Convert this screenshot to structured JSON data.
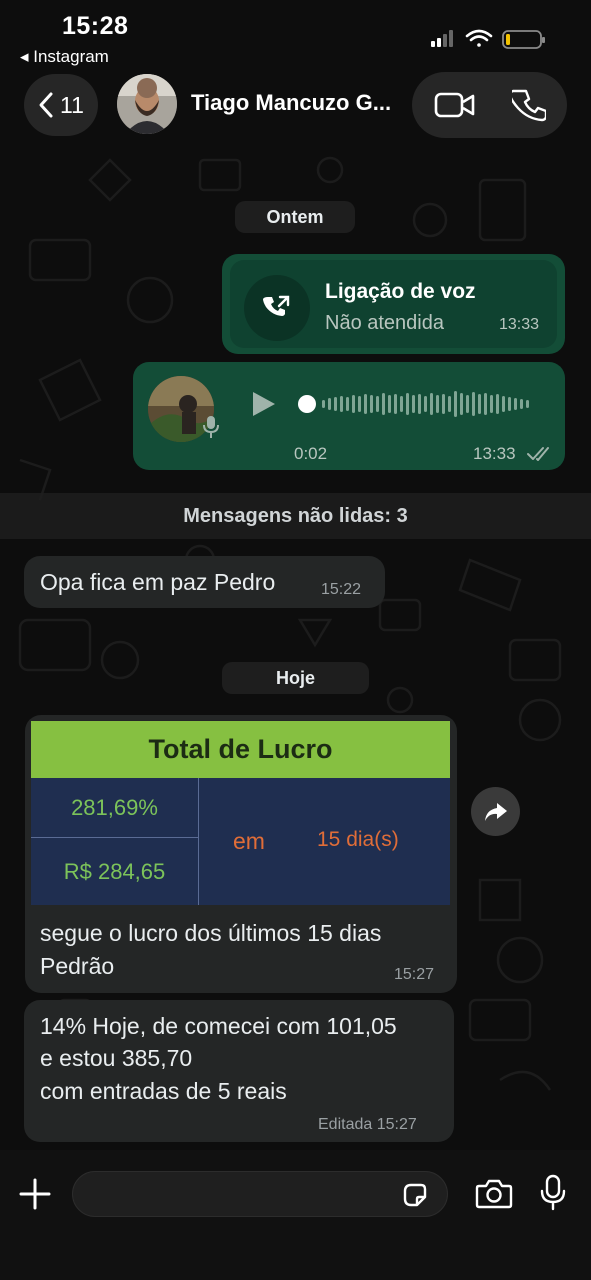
{
  "status_bar": {
    "time": "15:28",
    "back_app": "◂ Instagram"
  },
  "header": {
    "back_count": "11",
    "contact_name": "Tiago Mancuzo G..."
  },
  "chat": {
    "date_yesterday": "Ontem",
    "call": {
      "title": "Ligação de voz",
      "subtitle": "Não atendida",
      "time": "13:33"
    },
    "voice": {
      "duration": "0:02",
      "time": "13:33"
    },
    "unread_label": "Mensagens não lidas: 3",
    "msg1": {
      "text": "Opa fica em paz Pedro",
      "time": "15:22"
    },
    "date_today": "Hoje",
    "image_table": {
      "header": "Total de Lucro",
      "percent": "281,69%",
      "amount": "R$ 284,65",
      "em": "em",
      "days": "15 dia(s)"
    },
    "msg2": {
      "line1": "segue o lucro dos últimos 15 dias",
      "line2": "Pedrão",
      "time": "15:27"
    },
    "msg3": {
      "line1": "14% Hoje, de comecei com 101,05",
      "line2": "e estou  385,70",
      "line3": "com entradas de 5 reais",
      "edited_time": "Editada 15:27"
    }
  },
  "composer": {
    "value": ""
  },
  "colors": {
    "outgoing_bubble": "#134d37",
    "incoming_bubble": "#242626",
    "table_header": "#86c041",
    "table_body": "#1f2e50"
  }
}
